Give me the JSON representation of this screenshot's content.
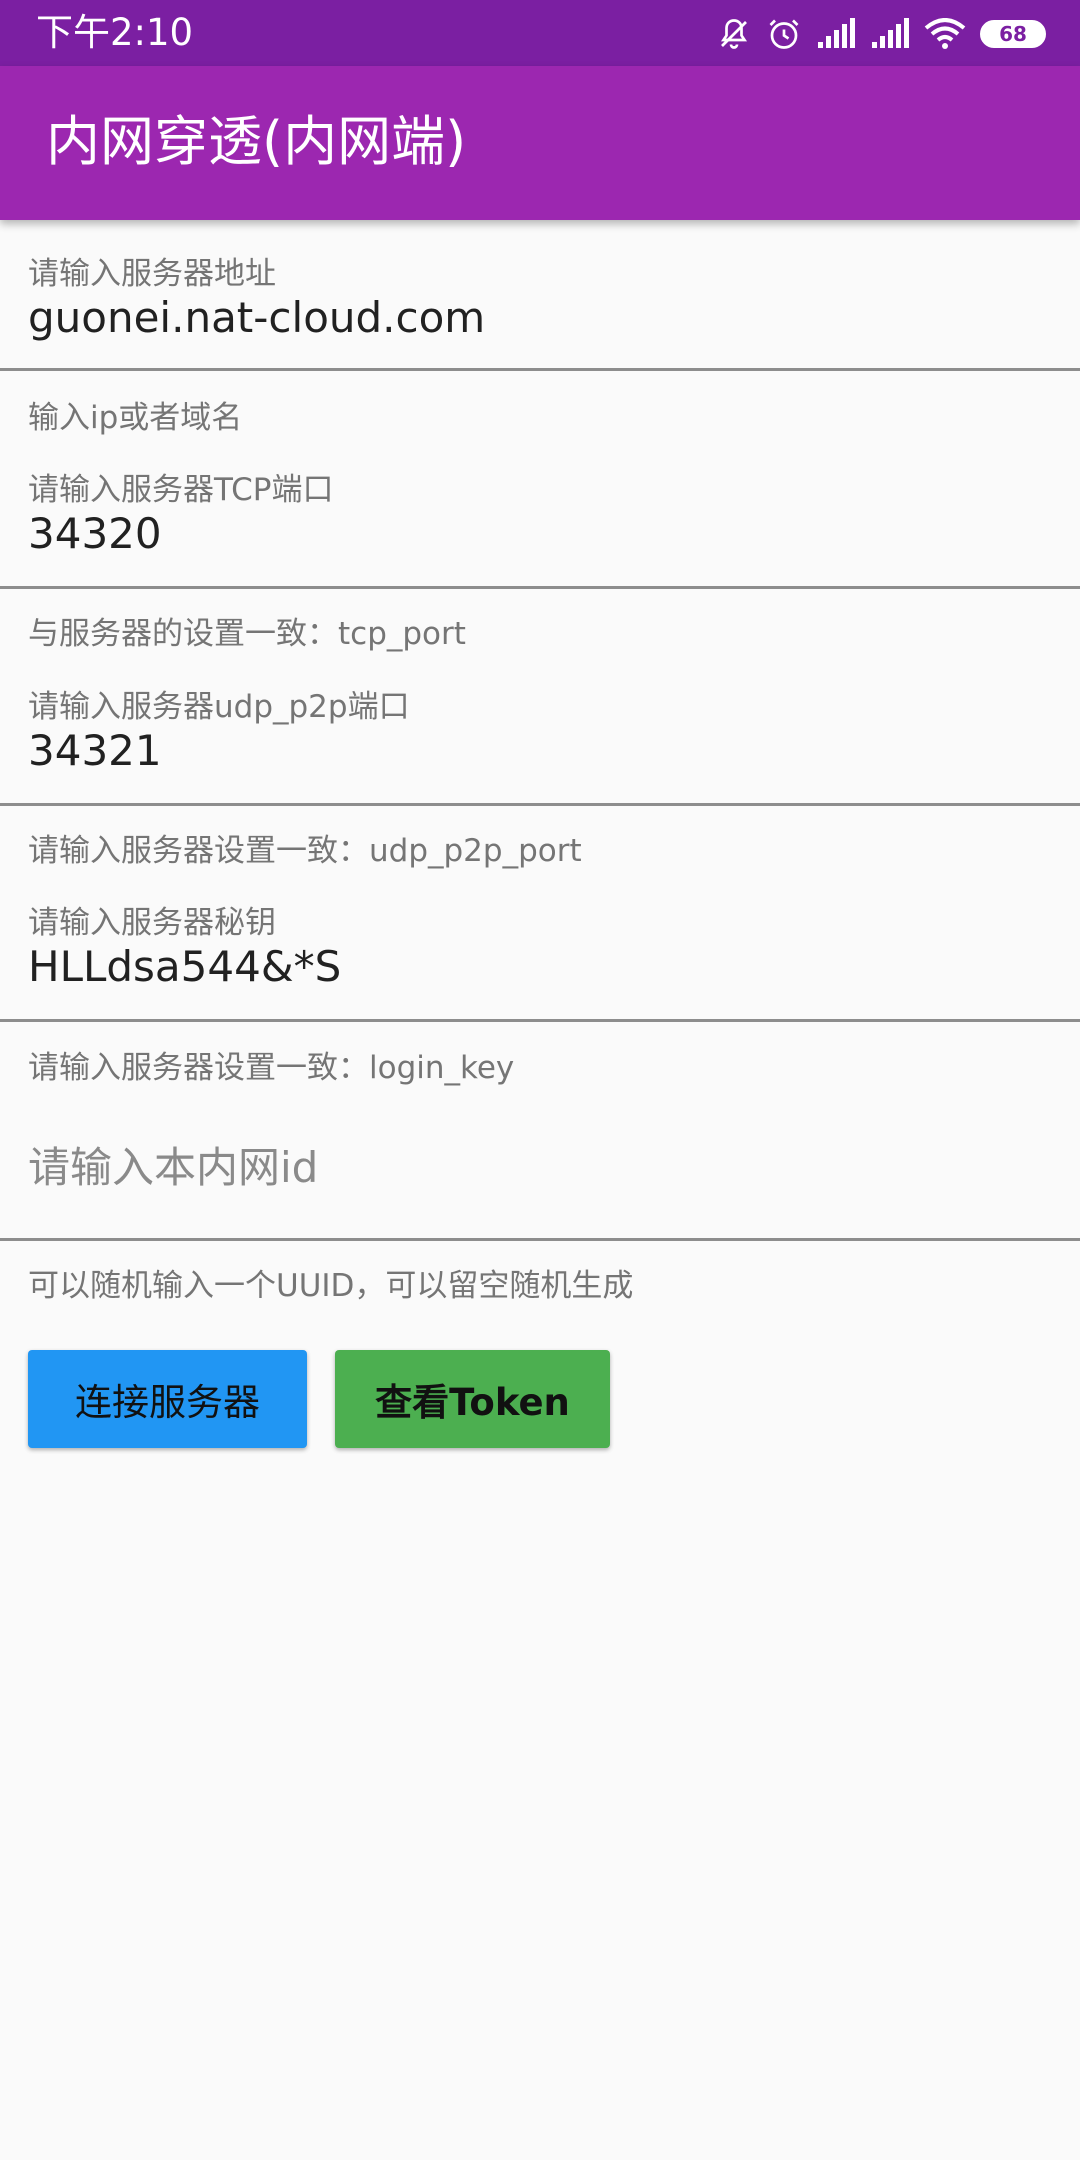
{
  "status_bar": {
    "time": "下午2:10",
    "battery": "68",
    "icons": [
      "muted-bell-icon",
      "alarm-icon",
      "signal-icon",
      "signal-icon",
      "wifi-icon",
      "battery-icon"
    ]
  },
  "app_bar": {
    "title": "内网穿透(内网端)"
  },
  "form": {
    "server_address": {
      "label": "请输入服务器地址",
      "value": "guonei.nat-cloud.com",
      "helper": "输入ip或者域名"
    },
    "tcp_port": {
      "label": "请输入服务器TCP端口",
      "value": "34320",
      "helper": "与服务器的设置一致：tcp_port"
    },
    "udp_port": {
      "label": "请输入服务器udp_p2p端口",
      "value": "34321",
      "helper": "请输入服务器设置一致：udp_p2p_port"
    },
    "secret_key": {
      "label": "请输入服务器秘钥",
      "value": "HLLdsa544&*S",
      "helper": "请输入服务器设置一致：login_key"
    },
    "intranet_id": {
      "placeholder": "请输入本内网id",
      "helper": "可以随机输入一个UUID，可以留空随机生成"
    }
  },
  "buttons": {
    "connect_label": "连接服务器",
    "token_label": "查看Token"
  },
  "colors": {
    "status_bar": "#7b1fa2",
    "app_bar": "#9c27b0",
    "connect_button": "#2196f3",
    "token_button": "#4caf50"
  }
}
